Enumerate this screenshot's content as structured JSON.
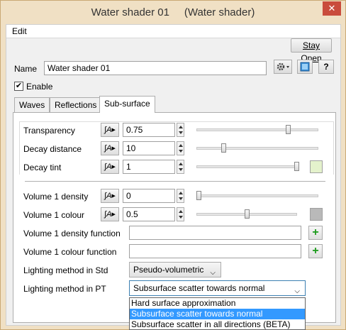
{
  "window": {
    "title": "Water shader 01",
    "title_type": "(Water shader)",
    "close_glyph": "✕"
  },
  "menu": {
    "edit": "Edit"
  },
  "toolbar": {
    "stay_open": "Stay Open"
  },
  "name_row": {
    "label": "Name",
    "value": "Water shader 01",
    "help_glyph": "?"
  },
  "enable": {
    "label": "Enable",
    "checked_glyph": "✔"
  },
  "tabs": [
    {
      "label": "Waves",
      "active": false
    },
    {
      "label": "Reflections",
      "active": false
    },
    {
      "label": "Sub-surface",
      "active": true
    }
  ],
  "params": {
    "transparency": {
      "label": "Transparency",
      "value": "0.75",
      "slider_fraction": 0.75
    },
    "decay_distance": {
      "label": "Decay distance",
      "value": "10",
      "slider_fraction": 0.2
    },
    "decay_tint": {
      "label": "Decay tint",
      "value": "1",
      "slider_fraction": 1.0,
      "swatch_color": "#e4f2cc"
    },
    "volume1_density": {
      "label": "Volume 1 density",
      "value": "0",
      "slider_fraction": 0.0
    },
    "volume1_colour": {
      "label": "Volume 1 colour",
      "value": "0.5",
      "slider_fraction": 0.5,
      "swatch_color": "#b9b9b9"
    },
    "volume1_density_function": {
      "label": "Volume 1 density function",
      "value": ""
    },
    "volume1_colour_function": {
      "label": "Volume 1 colour function",
      "value": ""
    },
    "lighting_std": {
      "label": "Lighting method in Std",
      "value": "Pseudo-volumetric"
    },
    "lighting_pt": {
      "label": "Lighting method in PT",
      "value": "Subsurface scatter towards normal",
      "options": [
        "Hard surface approximation",
        "Subsurface scatter towards normal",
        "Subsurface scatter in all directions (BETA)"
      ],
      "selected_index": 1
    }
  },
  "anim_glyph": "∫A▸",
  "add_glyph": "+",
  "colors": {
    "accent": "#3399ff",
    "title_bar": "#f0e0c4",
    "close": "#c94c3c"
  }
}
